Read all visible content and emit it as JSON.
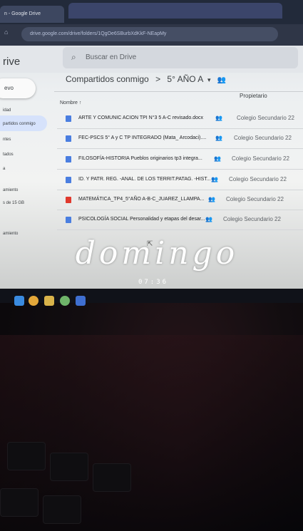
{
  "browser": {
    "tab_title": "n - Google Drive",
    "url": "drive.google.com/drive/folders/1QgOe6SBurbXdKkF-NEapMy"
  },
  "app": {
    "name": "rive",
    "search_placeholder": "Buscar en Drive"
  },
  "sidebar": {
    "new_label": "evo",
    "items": [
      "idad",
      "partidos conmigo",
      "ntes",
      "tados",
      "a",
      "amiento",
      "s de 15 GB",
      "amiento"
    ]
  },
  "breadcrumb": {
    "root": "Compartidos conmigo",
    "separator": ">",
    "folder": "5° AÑO A",
    "caret": "▾"
  },
  "columns": {
    "name": "Nombre ↑",
    "owner": "Propietario"
  },
  "files": [
    {
      "name": "ARTE Y COMUNIC ACION TPI N°3 5 A-C revisado.docx",
      "owner": "Colegio Secundario 22",
      "type": "doc"
    },
    {
      "name": "FEC-PSCS 5° A y C TP INTEGRADO (Mata_ Arcodaci)....",
      "owner": "Colegio Secundario 22",
      "type": "doc"
    },
    {
      "name": "FILOSOFÍA-HISTORIA Pueblos originarios tp3 integra...",
      "owner": "Colegio Secundario 22",
      "type": "doc"
    },
    {
      "name": "ID. Y PATR. REG. -ANAL. DE LOS TERRIT.PATAG. -HIST...",
      "owner": "Colegio Secundario 22",
      "type": "doc"
    },
    {
      "name": "MATEMÁTICA_TP4_5°AÑO A-B-C_JUAREZ_LLAMPA...",
      "owner": "Colegio Secundario 22",
      "type": "pdf"
    },
    {
      "name": "PSICOLOGÍA SOCIAL Personalidad y etapas del desar...",
      "owner": "Colegio Secundario 22",
      "type": "doc"
    }
  ],
  "overlay": {
    "word": "domingo",
    "time": "07:36"
  },
  "colors": {
    "doc_icon": "#4a7ee0",
    "pdf_icon": "#e0392d",
    "overlay_text": "#ffffff"
  }
}
